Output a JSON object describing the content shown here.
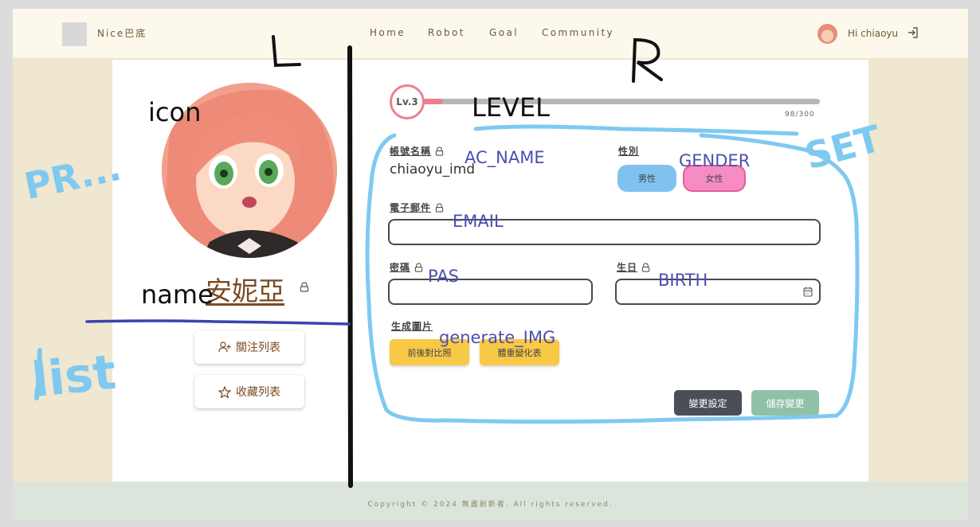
{
  "header": {
    "brand": "Nice巴底",
    "nav": [
      "Home",
      "Robot",
      "Goal",
      "Community"
    ],
    "greeting": "Hi chiaoyu"
  },
  "profile": {
    "name": "安妮亞",
    "follow_list": "關注列表",
    "fav_list": "收藏列表"
  },
  "level": {
    "badge": "Lv.3",
    "xp_text": "98/300",
    "progress": 0.08
  },
  "settings": {
    "account_label": "帳號名稱",
    "account_value": "chiaoyu_imd",
    "gender_label": "性別",
    "gender_options": [
      "男性",
      "女性"
    ],
    "email_label": "電子郵件",
    "password_label": "密碼",
    "birth_label": "生日",
    "generate_label": "生成圖片",
    "generate_buttons": [
      "前後對比照",
      "體重變化表"
    ],
    "change_button": "變更設定",
    "save_button": "儲存變更"
  },
  "footer": {
    "copyright": "Copyright © 2024 無盡創新者. All rights reserved."
  },
  "annotations": {
    "L": "L",
    "R": "R",
    "icon": "icon",
    "name": "name",
    "list": "list",
    "pr": "PR...",
    "set": "SET",
    "level": "LEVEL",
    "ac_name": "AC_NAME",
    "gender": "GENDER",
    "email": "EMAIL",
    "pas": "PAS",
    "birth": "BIRTH",
    "gen_img": "generate_IMG"
  },
  "colors": {
    "accent_pink": "#ee7f8e",
    "male_blue": "#7fc2ef",
    "female_pink": "#f68cc4",
    "yellow": "#f8c847",
    "dark_btn": "#4a4e57",
    "green_btn": "#8fc1a6",
    "annotation_blue": "#7fc9f0",
    "annotation_purple": "#4b4fae"
  }
}
